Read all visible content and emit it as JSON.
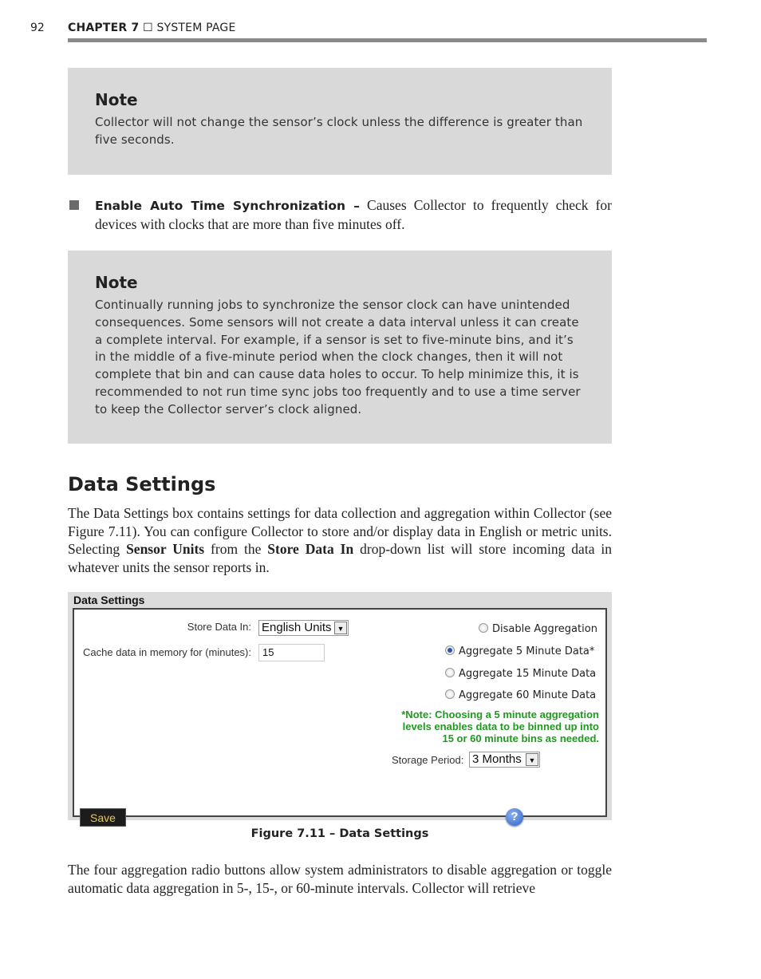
{
  "header": {
    "page_number": "92",
    "chapter": "CHAPTER 7",
    "separator_icon": "box-icon",
    "section": "SYSTEM PAGE"
  },
  "note1": {
    "title": "Note",
    "text": "Collector will not change the sensor’s clock unless the difference is greater than five seconds."
  },
  "bullet": {
    "icon": "square-bullet",
    "term": "Enable Auto Time Synchronization –",
    "text": " Causes Collector to frequently check for devices with clocks that are more than five minutes off."
  },
  "note2": {
    "title": "Note",
    "text": "Continually running jobs to synchronize the sensor clock can have unintended consequences. Some sensors will not create a data interval unless it can create a complete interval. For example, if a sensor is set to five-minute bins, and it’s in the middle of a five-minute period when the clock changes, then it will not complete that bin and can cause data holes to occur. To help minimize this, it is recommended to not run time sync jobs too frequently and to use a time server to keep the Collector server’s clock aligned."
  },
  "section": {
    "heading": "Data Settings",
    "para1_a": "The Data Settings box contains settings for data collection and aggregation within Collector (see Figure 7.11). You can configure Collector to store and/or display data in English or metric units. Selecting ",
    "para1_b": "Sensor Units",
    "para1_c": " from the ",
    "para1_d": "Store Data In",
    "para1_e": " drop-down list will store incoming data in whatever units the sensor reports in.",
    "para2": "The four aggregation radio buttons allow system administrators to disable aggregation or toggle automatic data aggregation in 5-, 15-, or 60-minute intervals. Collector will retrieve"
  },
  "figure": {
    "title": "Data Settings",
    "store_label": "Store Data In:",
    "store_value": "English Units",
    "cache_label": "Cache data in memory for (minutes):",
    "cache_value": "15",
    "radios": [
      {
        "label": "Disable Aggregation",
        "checked": false
      },
      {
        "label": "Aggregate 5 Minute Data*",
        "checked": true
      },
      {
        "label": "Aggregate 15 Minute Data",
        "checked": false
      },
      {
        "label": "Aggregate 60 Minute Data",
        "checked": false
      }
    ],
    "note_lines": [
      "*Note: Choosing a 5 minute aggregation",
      "levels enables data to be binned up into",
      "15 or 60 minute bins as needed."
    ],
    "note_color": "#1f9a1f",
    "storage_label": "Storage Period:",
    "storage_value": "3 Months",
    "save_label": "Save",
    "help_icon": "?"
  },
  "caption": "Figure 7.11 – Data Settings"
}
